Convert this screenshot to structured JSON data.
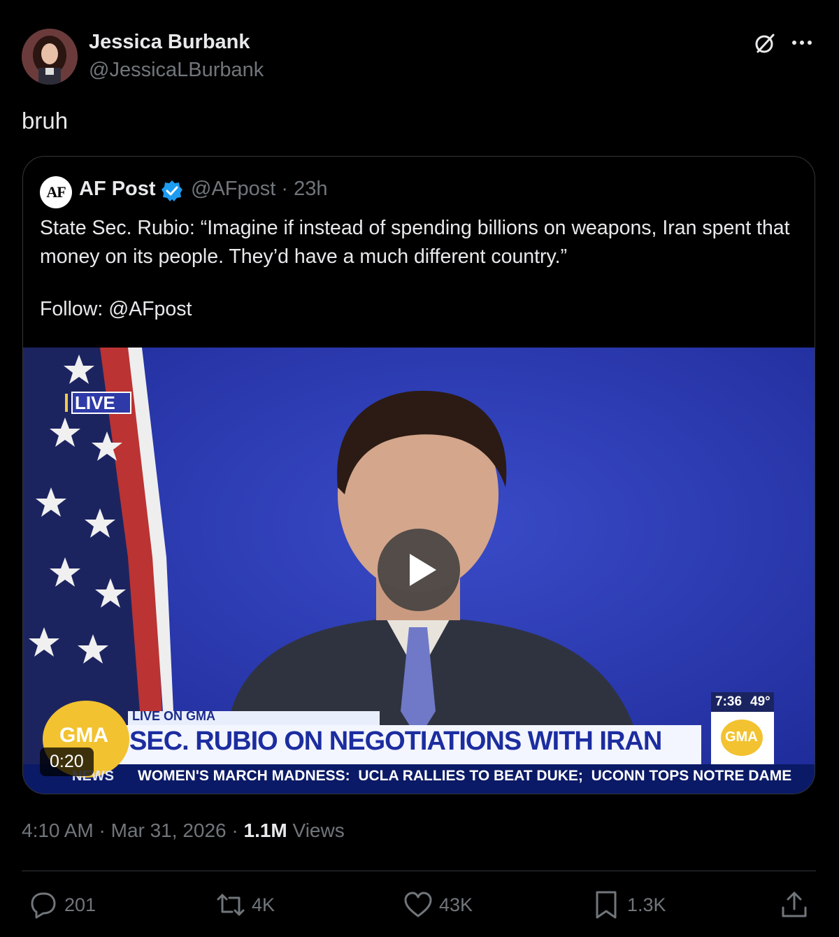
{
  "author": {
    "name": "Jessica Burbank",
    "handle": "@JessicaLBurbank"
  },
  "header_icons": [
    "grok-icon",
    "more-icon"
  ],
  "tweet": {
    "text": "bruh"
  },
  "quoted": {
    "logo_text": "AF",
    "name": "AF Post",
    "verified": true,
    "handle_time": "@AFpost · 23h",
    "text": "State Sec. Rubio: “Imagine if instead of spending billions on weapons, Iran spent that money on its people. They’d have a much different country.”",
    "follow": "Follow: @AFpost",
    "video": {
      "duration": "0:20",
      "live_badge": "LIVE",
      "lower_third_top": "LIVE ON GMA",
      "headline": "SEC. RUBIO ON NEGOTIATIONS WITH IRAN",
      "ticker": "WOMEN'S MARCH MADNESS:  UCLA RALLIES TO BEAT DUKE;  UCONN TOPS NOTRE DAME",
      "ticker_tag": "NEWS",
      "clock": "7:36",
      "temp": "49°",
      "network_logo": "GMA"
    }
  },
  "meta": {
    "time_date": "4:10 AM · Mar 31, 2026 · ",
    "views_count": "1.1M",
    "views_label": " Views"
  },
  "actions": {
    "replies": "201",
    "reposts": "4K",
    "likes": "43K",
    "bookmarks": "1.3K"
  },
  "colors": {
    "background": "#000000",
    "text": "#e7e9ea",
    "secondary": "#71767b",
    "verified": "#1d9bf0"
  }
}
